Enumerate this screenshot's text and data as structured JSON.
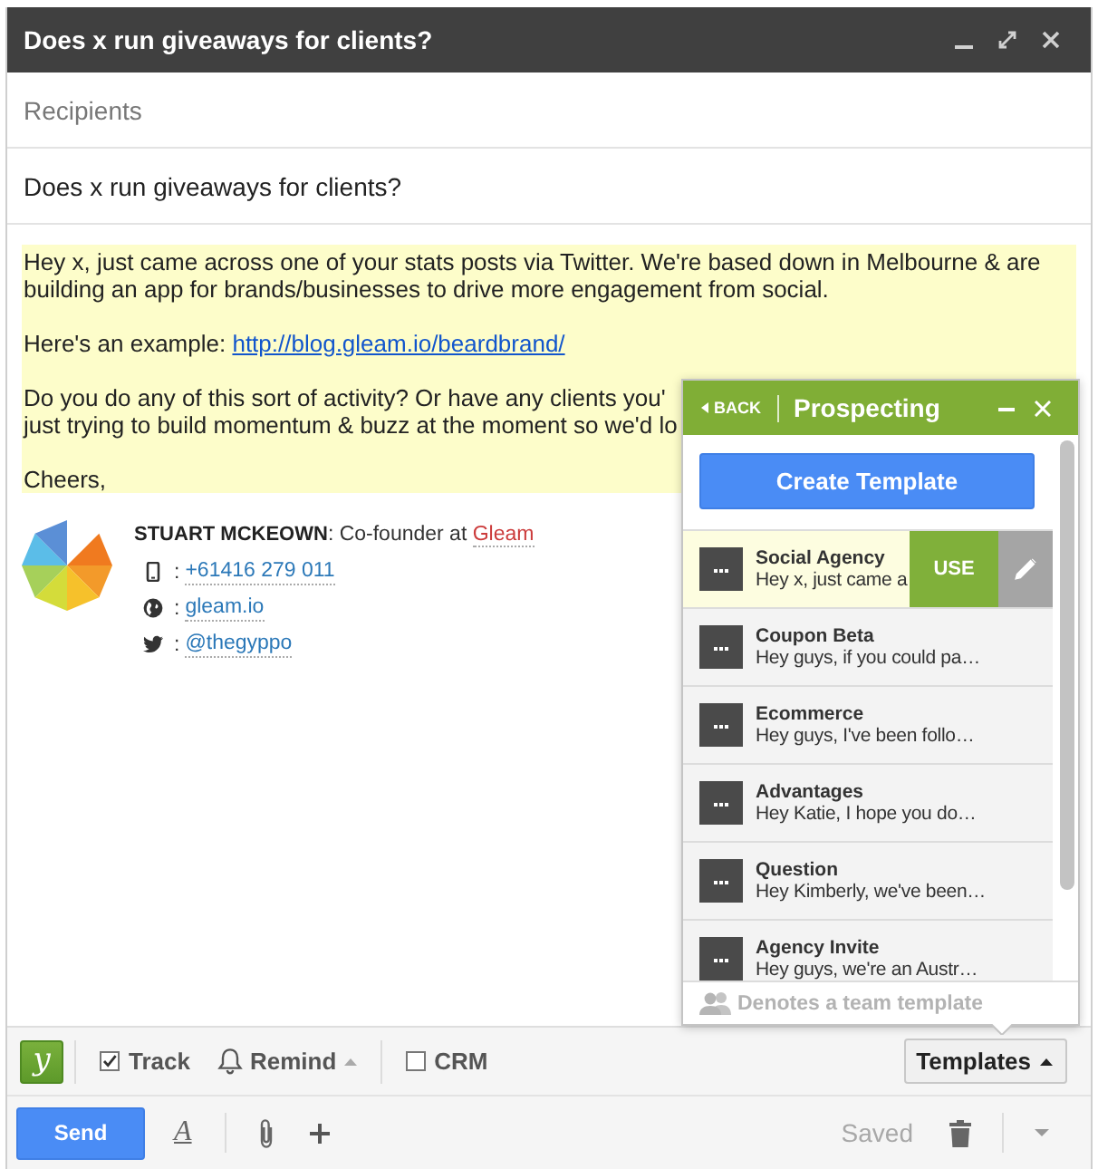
{
  "window": {
    "title": "Does x run giveaways for clients?"
  },
  "recipients": {
    "placeholder": "Recipients"
  },
  "subject": {
    "value": "Does x run giveaways for clients?"
  },
  "body": {
    "highlighted": true,
    "paragraphs": [
      {
        "lines": [
          "Hey x, just came across one of your stats posts via Twitter. We're based down in Melbourne & are",
          "building an app for brands/businesses to drive more engagement from social."
        ]
      },
      {
        "lines": [
          "Here's an example: "
        ],
        "link": "http://blog.gleam.io/beardbrand/"
      },
      {
        "lines": [
          "Do you do any of this sort of activity? Or have any clients you'",
          "just trying to build momentum & buzz at the moment so we'd lo"
        ]
      },
      {
        "lines": [
          "Cheers,"
        ]
      }
    ]
  },
  "signature": {
    "title": "**STUART MCKEOWN**: Co-founder at ",
    "company": "Gleam",
    "contacts": [
      {
        "kind": "phone",
        "separator": ":",
        "value": "+61416 279 011"
      },
      {
        "kind": "web",
        "separator": ":",
        "value": "gleam.io"
      },
      {
        "kind": "twitter",
        "separator": ":",
        "value": "@thegyppo"
      }
    ]
  },
  "templates_panel": {
    "back": "BACK",
    "title": "Prospecting",
    "create_button": "Create Template",
    "use_button": "USE",
    "templates": [
      {
        "name": "Social Agency",
        "preview": "Hey x, just came a",
        "selected": true
      },
      {
        "name": "Coupon Beta",
        "preview": "Hey guys, if you could pa…",
        "selected": false
      },
      {
        "name": "Ecommerce",
        "preview": "Hey guys, I've been follo…",
        "selected": false
      },
      {
        "name": "Advantages",
        "preview": "Hey Katie, I hope you do…",
        "selected": false
      },
      {
        "name": "Question",
        "preview": "Hey Kimberly, we've been…",
        "selected": false
      },
      {
        "name": "Agency Invite",
        "preview": "Hey guys, we're an Austr…",
        "selected": false
      }
    ],
    "footer_note": "Denotes a team template"
  },
  "toolbar": {
    "logo": "y",
    "track": {
      "label": "Track",
      "checked": true
    },
    "remind": {
      "label": "Remind"
    },
    "crm": {
      "label": "CRM",
      "checked": false
    },
    "templates_button": {
      "label": "Templates"
    }
  },
  "send_bar": {
    "send": "Send",
    "format": "A",
    "status": "Saved"
  }
}
